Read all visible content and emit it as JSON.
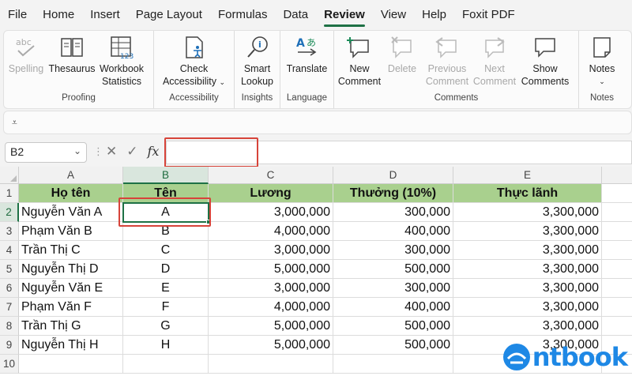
{
  "menu": {
    "tabs": [
      {
        "label": "File"
      },
      {
        "label": "Home"
      },
      {
        "label": "Insert"
      },
      {
        "label": "Page Layout"
      },
      {
        "label": "Formulas"
      },
      {
        "label": "Data"
      },
      {
        "label": "Review",
        "active": true
      },
      {
        "label": "View"
      },
      {
        "label": "Help"
      },
      {
        "label": "Foxit PDF"
      }
    ]
  },
  "ribbon": {
    "proofing": {
      "label": "Proofing",
      "spelling": "Spelling",
      "thesaurus": "Thesaurus",
      "workbook_stats_1": "Workbook",
      "workbook_stats_2": "Statistics"
    },
    "accessibility": {
      "label": "Accessibility",
      "check_1": "Check",
      "check_2": "Accessibility"
    },
    "insights": {
      "label": "Insights",
      "smart_1": "Smart",
      "smart_2": "Lookup"
    },
    "language": {
      "label": "Language",
      "translate": "Translate"
    },
    "comments": {
      "label": "Comments",
      "new_1": "New",
      "new_2": "Comment",
      "delete": "Delete",
      "prev_1": "Previous",
      "prev_2": "Comment",
      "next_1": "Next",
      "next_2": "Comment",
      "show_1": "Show",
      "show_2": "Comments"
    },
    "notes": {
      "label": "Notes",
      "notes": "Notes"
    }
  },
  "formula_bar": {
    "name_box": "B2",
    "fx": "fx",
    "value": ""
  },
  "sheet": {
    "columns": [
      "A",
      "B",
      "C",
      "D",
      "E"
    ],
    "rows": [
      "1",
      "2",
      "3",
      "4",
      "5",
      "6",
      "7",
      "8",
      "9",
      "10"
    ],
    "header": [
      "Họ tên",
      "Tên",
      "Lương",
      "Thưởng (10%)",
      "Thực lãnh"
    ],
    "data": [
      [
        "Nguyễn Văn A",
        "A",
        "3,000,000",
        "300,000",
        "3,300,000"
      ],
      [
        "Phạm Văn B",
        "B",
        "4,000,000",
        "400,000",
        "3,300,000"
      ],
      [
        "Trần Thị C",
        "C",
        "3,000,000",
        "300,000",
        "3,300,000"
      ],
      [
        "Nguyễn Thị D",
        "D",
        "5,000,000",
        "500,000",
        "3,300,000"
      ],
      [
        "Nguyễn Văn E",
        "E",
        "3,000,000",
        "300,000",
        "3,300,000"
      ],
      [
        "Phạm Văn F",
        "F",
        "4,000,000",
        "400,000",
        "3,300,000"
      ],
      [
        "Trần Thị G",
        "G",
        "5,000,000",
        "500,000",
        "3,300,000"
      ],
      [
        "Nguyễn Thị H",
        "H",
        "5,000,000",
        "500,000",
        "3,300,000"
      ]
    ],
    "header_fill": "#a9d08e",
    "selection_color": "#1e7145"
  },
  "highlight_color": "#d7443a",
  "watermark": "ntbook"
}
